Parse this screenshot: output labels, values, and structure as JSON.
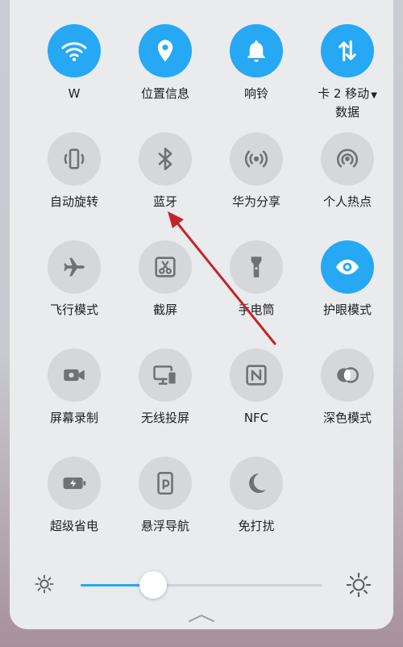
{
  "tiles": [
    {
      "id": "wifi",
      "label": "W",
      "icon": "wifi-icon",
      "active": true
    },
    {
      "id": "location",
      "label": "位置信息",
      "icon": "location-pin-icon",
      "active": true
    },
    {
      "id": "ring",
      "label": "响铃",
      "icon": "bell-icon",
      "active": true
    },
    {
      "id": "mobile-data",
      "label_line1": "卡 2 移动",
      "label_line2": "数据",
      "icon": "data-arrows-icon",
      "active": true
    },
    {
      "id": "auto-rotate",
      "label": "自动旋转",
      "icon": "rotate-icon",
      "active": false
    },
    {
      "id": "bluetooth",
      "label": "蓝牙",
      "icon": "bluetooth-icon",
      "active": false
    },
    {
      "id": "huawei-share",
      "label": "华为分享",
      "icon": "share-waves-icon",
      "active": false
    },
    {
      "id": "hotspot",
      "label": "个人热点",
      "icon": "hotspot-icon",
      "active": false
    },
    {
      "id": "airplane",
      "label": "飞行模式",
      "icon": "airplane-icon",
      "active": false
    },
    {
      "id": "screenshot",
      "label": "截屏",
      "icon": "screenshot-icon",
      "active": false
    },
    {
      "id": "flashlight",
      "label": "手电筒",
      "icon": "flashlight-icon",
      "active": false
    },
    {
      "id": "eye-comfort",
      "label": "护眼模式",
      "icon": "eye-icon",
      "active": true
    },
    {
      "id": "screen-record",
      "label": "屏幕录制",
      "icon": "camera-record-icon",
      "active": false
    },
    {
      "id": "wireless-projection",
      "label": "无线投屏",
      "icon": "projection-icon",
      "active": false
    },
    {
      "id": "nfc",
      "label": "NFC",
      "icon": "nfc-icon",
      "active": false
    },
    {
      "id": "dark-mode",
      "label": "深色模式",
      "icon": "dark-mode-icon",
      "active": false
    },
    {
      "id": "power-saving",
      "label": "超级省电",
      "icon": "battery-icon",
      "active": false
    },
    {
      "id": "floating-nav",
      "label": "悬浮导航",
      "icon": "floating-nav-icon",
      "active": false
    },
    {
      "id": "do-not-disturb",
      "label": "免打扰",
      "icon": "moon-icon",
      "active": false
    }
  ],
  "brightness": {
    "level": 0.3
  },
  "colors": {
    "accent": "#26a8f4",
    "inactive": "#d5d7da",
    "icon_inactive": "#6e7175",
    "annotation_arrow": "#c0262c"
  }
}
